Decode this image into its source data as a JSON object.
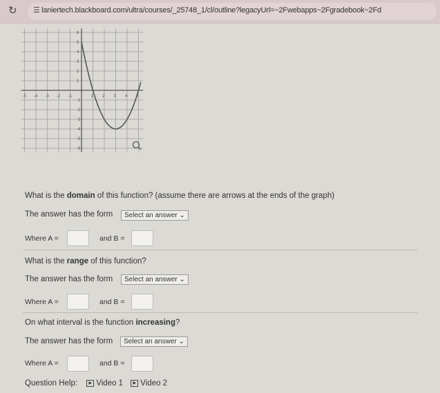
{
  "browser": {
    "url": "laniertech.blackboard.com/ultra/courses/_25748_1/cl/outline?legacyUrl=~2Fwebapps~2Fgradebook~2Fd"
  },
  "chart_data": {
    "type": "line",
    "function": "y = (x-3)^2 - 4",
    "x_start": 0,
    "x_end": 5.2,
    "xlim": [
      -5,
      5
    ],
    "ylim": [
      -6,
      6
    ],
    "xticks": [
      "-5",
      "-4",
      "-3",
      "-2",
      "-1",
      "1",
      "2",
      "3",
      "4",
      "5"
    ],
    "yticks": [
      "6",
      "5",
      "4",
      "3",
      "2",
      "1",
      "-1",
      "-2",
      "-3",
      "-4",
      "-5",
      "-6"
    ],
    "grid": true,
    "color": "#555555"
  },
  "q1": {
    "text_pre": "What is the ",
    "bold": "domain",
    "text_post": " of this function? (assume there are arrows at the ends of the graph)",
    "form": "The answer has the form",
    "select": "Select an answer",
    "where": "Where A =",
    "and": "and B ="
  },
  "q2": {
    "text_pre": "What is the ",
    "bold": "range",
    "text_post": " of this function?",
    "form": "The answer has the form",
    "select": "Select an answer",
    "where": "Where A =",
    "and": "and B ="
  },
  "q3": {
    "text_pre": "On what interval is the function ",
    "bold": "increasing",
    "text_post": "?",
    "form": "The answer has the form",
    "select": "Select an answer",
    "where": "Where A =",
    "and": "and B ="
  },
  "help": {
    "label": "Question Help:",
    "video1": "Video 1",
    "video2": "Video 2"
  }
}
